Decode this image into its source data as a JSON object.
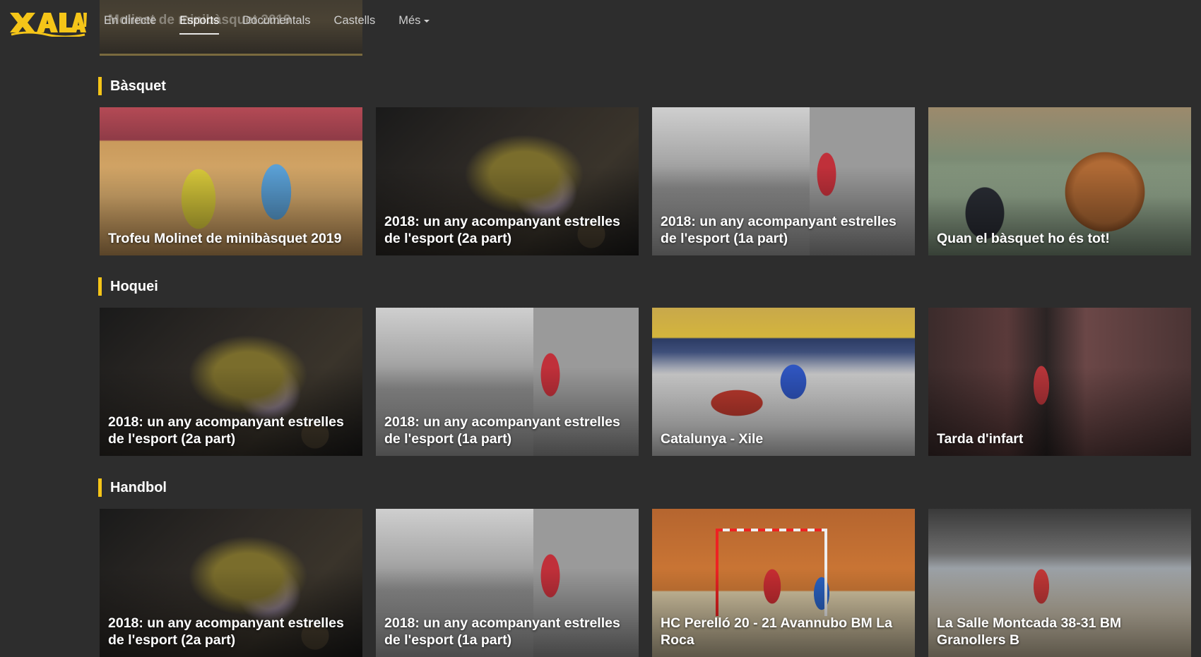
{
  "brand": {
    "logo_text": "XALA!",
    "accent": "#f5c518"
  },
  "nav": {
    "items": [
      {
        "label": "En directe",
        "active": false
      },
      {
        "label": "Esports",
        "active": true
      },
      {
        "label": "Documentals",
        "active": false
      },
      {
        "label": "Castells",
        "active": false
      },
      {
        "label": "Més",
        "active": false
      }
    ]
  },
  "peek": {
    "title": "Molinet de minibàsquet 2019"
  },
  "sections": [
    {
      "title": "Bàsquet",
      "cards": [
        {
          "title": "Trofeu Molinet de minibàsquet 2019"
        },
        {
          "title": "2018: un any acompanyant estrelles de l'esport (2a part)"
        },
        {
          "title": "2018: un any acompanyant estrelles de l'esport (1a part)"
        },
        {
          "title": "Quan el bàsquet ho és tot!"
        }
      ]
    },
    {
      "title": "Hoquei",
      "cards": [
        {
          "title": "2018: un any acompanyant estrelles de l'esport (2a part)"
        },
        {
          "title": "2018: un any acompanyant estrelles de l'esport (1a part)"
        },
        {
          "title": "Catalunya - Xile"
        },
        {
          "title": "Tarda d'infart"
        }
      ]
    },
    {
      "title": "Handbol",
      "cards": [
        {
          "title": "2018: un any acompanyant estrelles de l'esport (2a part)"
        },
        {
          "title": "2018: un any acompanyant estrelles de l'esport (1a part)"
        },
        {
          "title": "HC Perelló 20 - 21 Avannubo BM La Roca"
        },
        {
          "title": "La Salle Montcada 38-31 BM Granollers B"
        }
      ]
    }
  ]
}
